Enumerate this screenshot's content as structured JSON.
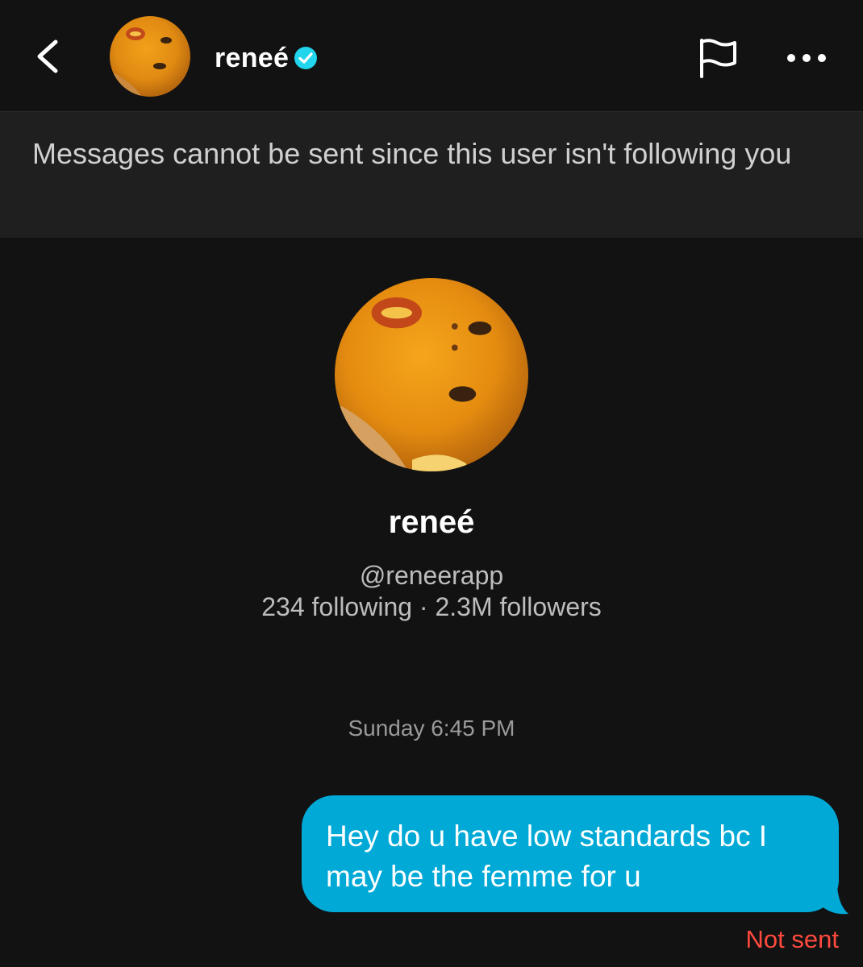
{
  "header": {
    "name": "reneé",
    "verified": true,
    "back_icon": "chevron-left-icon",
    "flag_icon": "flag-icon",
    "more_icon": "more-horizontal-icon"
  },
  "banner": {
    "text": "Messages cannot be sent since this user isn't following you"
  },
  "profile": {
    "name": "reneé",
    "handle": "@reneerapp",
    "stats": "234 following · 2.3M followers"
  },
  "conversation": {
    "timestamp": "Sunday 6:45 PM",
    "messages": [
      {
        "text": "Hey do u have low standards bc I may be the femme for u",
        "from": "me",
        "status": "Not sent"
      }
    ]
  },
  "colors": {
    "background": "#121212",
    "banner_background": "#1f1f1f",
    "bubble": "#00a9d6",
    "verified_badge": "#20d5ec",
    "error": "#ff4a3d"
  }
}
